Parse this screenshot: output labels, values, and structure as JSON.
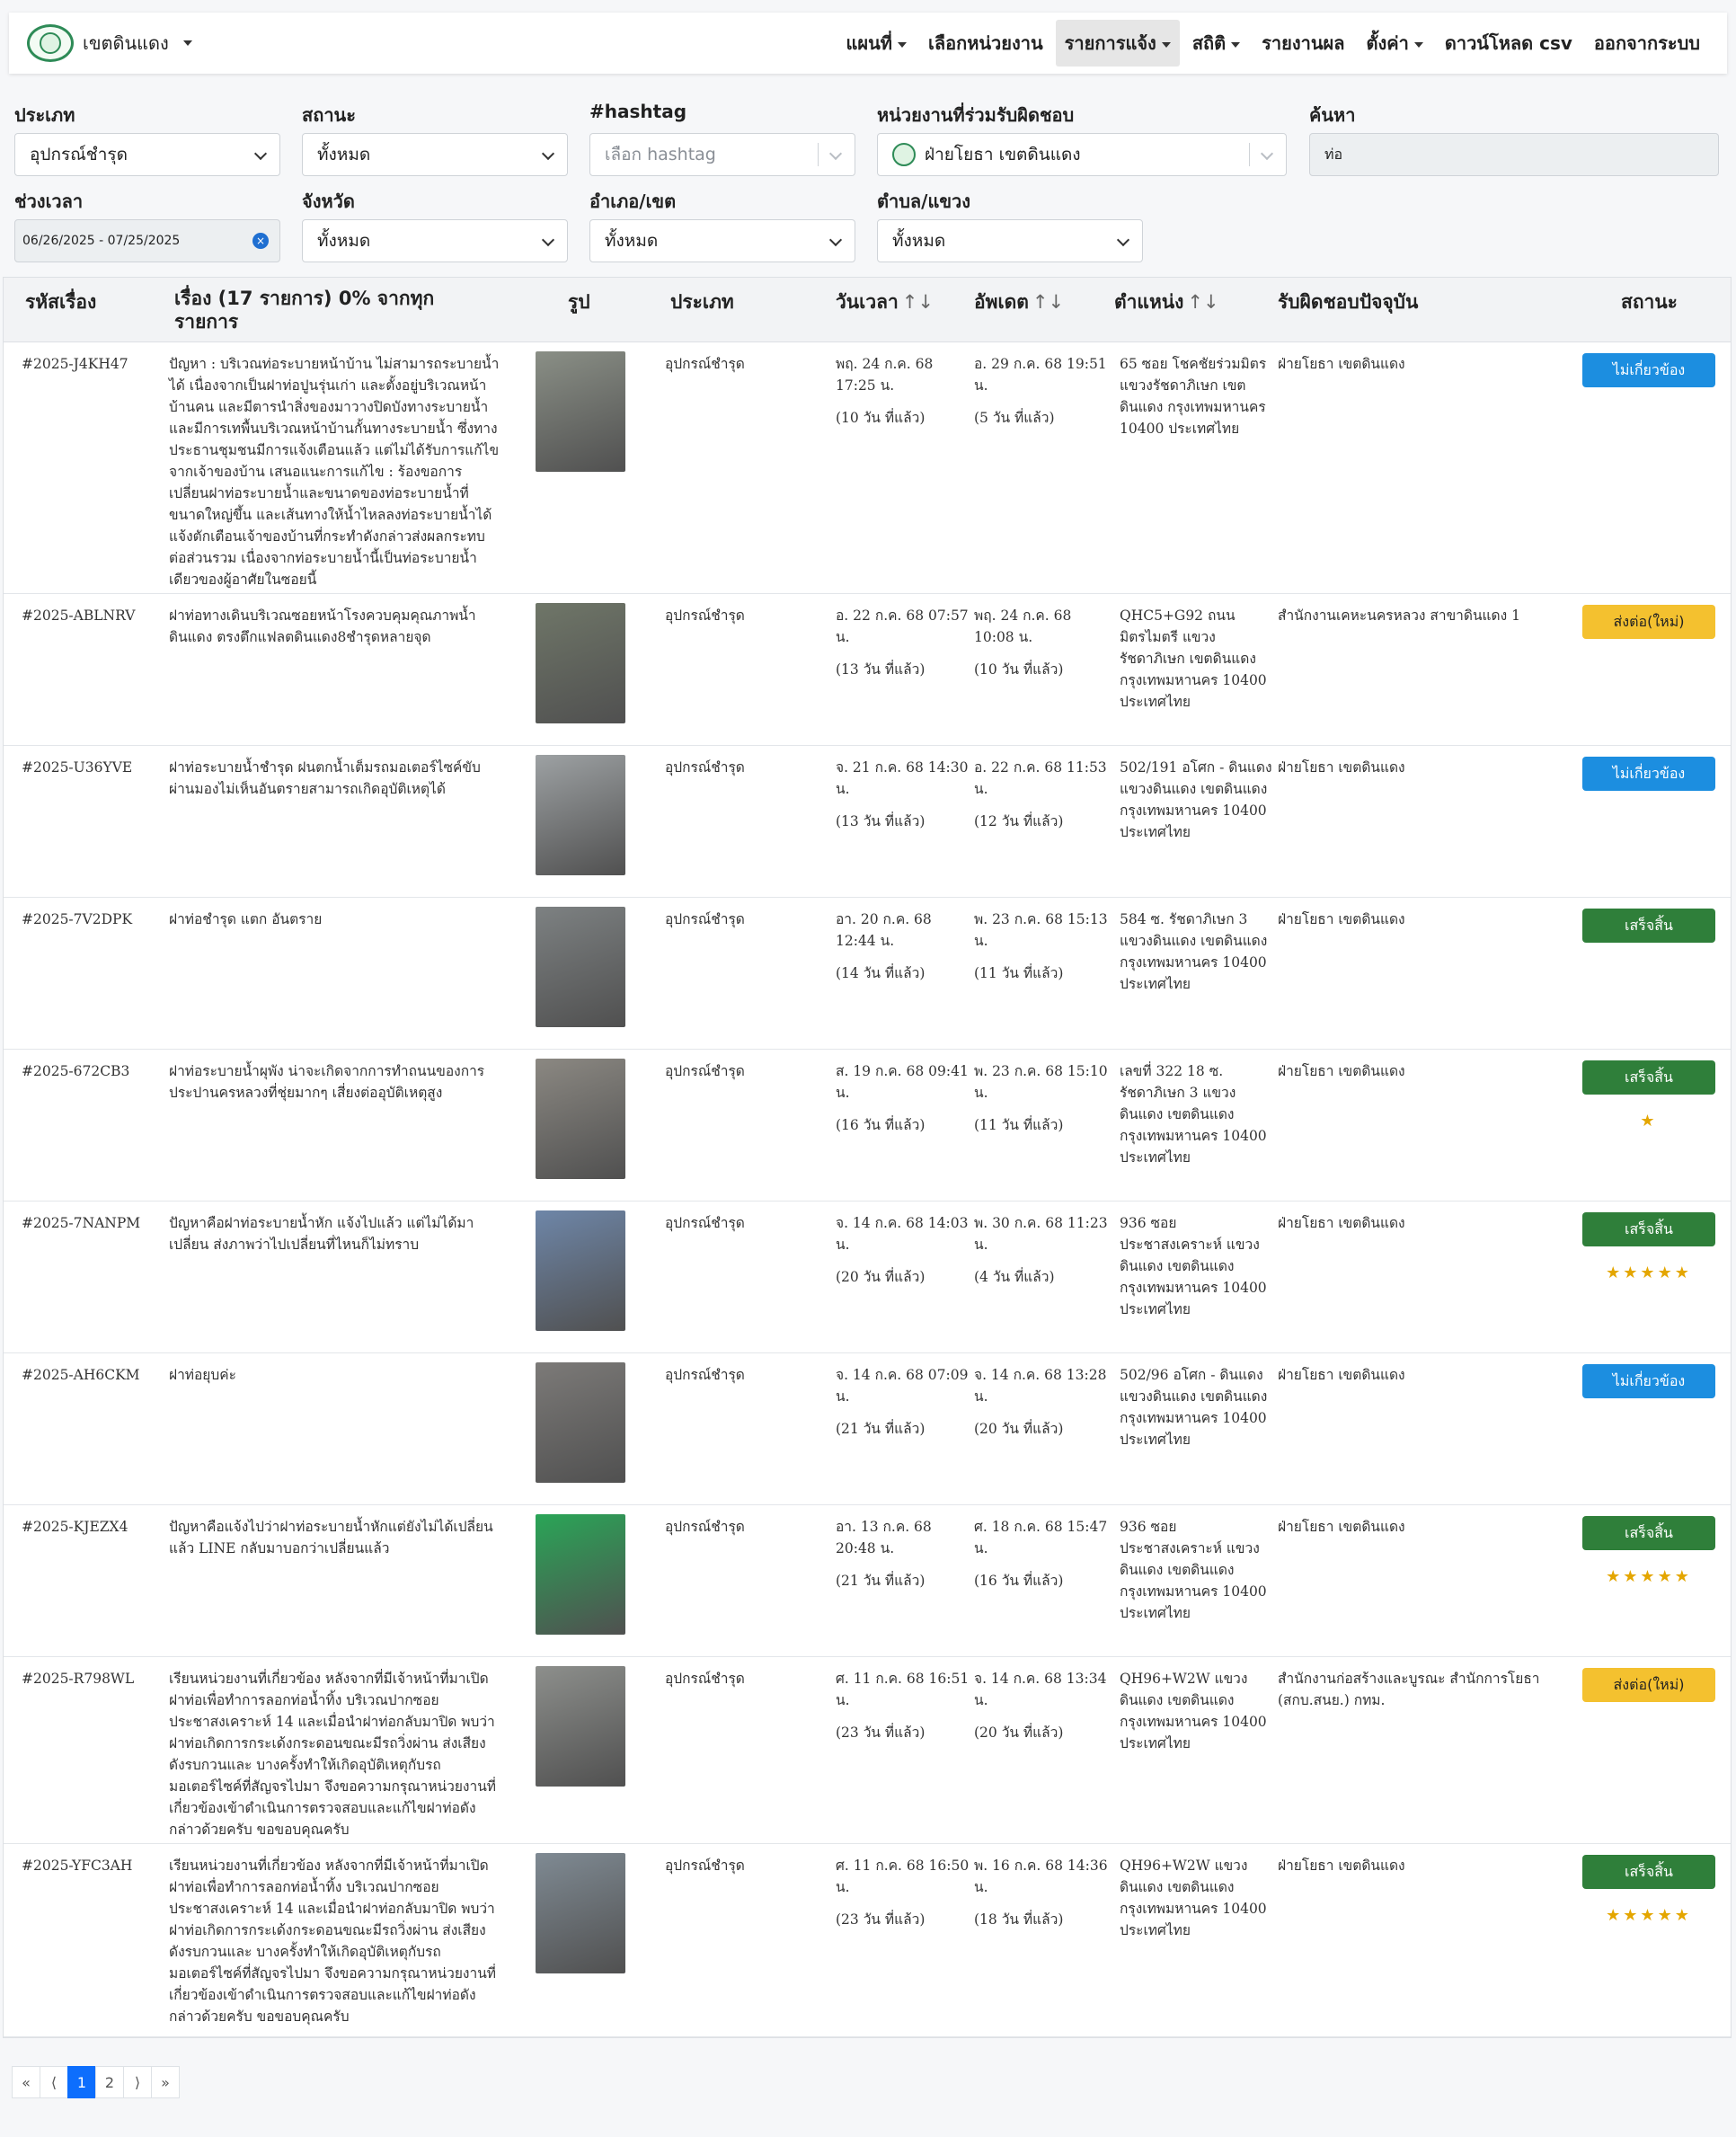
{
  "navbar": {
    "brand": "เขตดินแดง",
    "menu": [
      {
        "label": "แผนที่",
        "caret": true,
        "active": false
      },
      {
        "label": "เลือกหน่วยงาน",
        "caret": false,
        "active": false
      },
      {
        "label": "รายการแจ้ง",
        "caret": true,
        "active": true
      },
      {
        "label": "สถิติ",
        "caret": true,
        "active": false
      },
      {
        "label": "รายงานผล",
        "caret": false,
        "active": false
      },
      {
        "label": "ตั้งค่า",
        "caret": true,
        "active": false
      },
      {
        "label": "ดาวน์โหลด csv",
        "caret": false,
        "active": false
      },
      {
        "label": "ออกจากระบบ",
        "caret": false,
        "active": false
      }
    ]
  },
  "filters": {
    "type": {
      "label": "ประเภท",
      "value": "อุปกรณ์ชำรุด"
    },
    "status": {
      "label": "สถานะ",
      "value": "ทั้งหมด"
    },
    "hashtag": {
      "label": "#hashtag",
      "placeholder": "เลือก hashtag"
    },
    "unit": {
      "label": "หน่วยงานที่ร่วมรับผิดชอบ",
      "value": "ฝ่ายโยธา เขตดินแดง"
    },
    "search": {
      "label": "ค้นหา",
      "value": "ท่อ"
    },
    "period": {
      "label": "ช่วงเวลา",
      "value": "06/26/2025 - 07/25/2025"
    },
    "province": {
      "label": "จังหวัด",
      "value": "ทั้งหมด"
    },
    "district": {
      "label": "อำเภอ/เขต",
      "value": "ทั้งหมด"
    },
    "subdistrict": {
      "label": "ตำบล/แขวง",
      "value": "ทั้งหมด"
    }
  },
  "table": {
    "headers": {
      "id": "รหัสเรื่อง",
      "title": "เรื่อง (17 รายการ) 0% จากทุกรายการ",
      "image": "รูป",
      "type": "ประเภท",
      "date": "วันเวลา",
      "updated": "อัพเดต",
      "location": "ตำแหน่ง",
      "responsible": "รับผิดชอบปัจจุบัน",
      "status": "สถานะ",
      "sort_icon": "↑↓"
    },
    "rows": [
      {
        "id": "#2025-J4KH47",
        "title": "ปัญหา : บริเวณท่อระบายหน้าบ้าน ไม่สามารถระบายน้ำได้ เนื่องจากเป็นฝาท่อปูนรุ่นเก่า และตั้งอยู่บริเวณหน้าบ้านคน และมีตารนำสิ่งของมาวางปิดบังทางระบายน้ำ และมีการเทพื้นบริเวณหน้าบ้านกั้นทางระบายน้ำ ซึ่งทางประธานชุมชนมีการแจ้งเตือนแล้ว แต่ไม่ได้รับการแก้ไขจากเจ้าของบ้าน เสนอแนะการแก้ไข : ร้องขอการเปลี่ยนฝาท่อระบายน้ำและขนาดของท่อระบายน้ำที่ขนาดใหญ่ขึ้น และเส้นทางให้น้ำไหลลงท่อระบายน้ำได้ แจ้งตักเตือนเจ้าของบ้านที่กระทำดังกล่าวส่งผลกระทบต่อส่วนรวม เนื่องจากท่อระบายน้ำนี้เป็นท่อระบายน้ำเดียวของผู้อาศัยในซอยนี้",
        "type": "อุปกรณ์ชำรุด",
        "date": "พฤ. 24 ก.ค. 68 17:25 น.",
        "date_rel": "(10 วัน ที่แล้ว)",
        "updated": "อ. 29 ก.ค. 68 19:51 น.",
        "updated_rel": "(5 วัน ที่แล้ว)",
        "location": "65 ซอย โชคชัยร่วมมิตร แขวงรัชดาภิเษก เขตดินแดง กรุงเทพมหานคร 10400 ประเทศไทย",
        "responsible": "ฝ่ายโยธา เขตดินแดง",
        "status": "ไม่เกี่ยวข้อง",
        "status_color": "blue",
        "stars": "",
        "img_color": "#8a8f86"
      },
      {
        "id": "#2025-ABLNRV",
        "title": "ฝาท่อทางเดินบริเวณซอยหน้าโรงควบคุมคุณภาพน้ำดินแดง ตรงตึกแฟลตดินแดง8ชำรุดหลายจุด",
        "type": "อุปกรณ์ชำรุด",
        "date": "อ. 22 ก.ค. 68 07:57 น.",
        "date_rel": "(13 วัน ที่แล้ว)",
        "updated": "พฤ. 24 ก.ค. 68 10:08 น.",
        "updated_rel": "(10 วัน ที่แล้ว)",
        "location": "QHC5+G92 ถนนมิตรไมตรี แขวงรัชดาภิเษก เขตดินแดง กรุงเทพมหานคร 10400 ประเทศไทย",
        "responsible": "สำนักงานเคหะนครหลวง สาขาดินแดง 1",
        "status": "ส่งต่อ(ใหม่)",
        "status_color": "yellow",
        "stars": "",
        "img_color": "#6f7668"
      },
      {
        "id": "#2025-U36YVE",
        "title": "ฝาท่อระบายน้ำชำรุด ฝนตกน้ำเต็มรถมอเตอร์ไซค์ขับผ่านมองไม่เห็นอันตรายสามารถเกิดอุบัติเหตุได้",
        "type": "อุปกรณ์ชำรุด",
        "date": "จ. 21 ก.ค. 68 14:30 น.",
        "date_rel": "(13 วัน ที่แล้ว)",
        "updated": "อ. 22 ก.ค. 68 11:53 น.",
        "updated_rel": "(12 วัน ที่แล้ว)",
        "location": "502/191 อโศก - ดินแดง แขวงดินแดง เขตดินแดง กรุงเทพมหานคร 10400 ประเทศไทย",
        "responsible": "ฝ่ายโยธา เขตดินแดง",
        "status": "ไม่เกี่ยวข้อง",
        "status_color": "blue",
        "stars": "",
        "img_color": "#9da1a3"
      },
      {
        "id": "#2025-7V2DPK",
        "title": "ฝาท่อชำรุด แตก อันตราย",
        "type": "อุปกรณ์ชำรุด",
        "date": "อา. 20 ก.ค. 68 12:44 น.",
        "date_rel": "(14 วัน ที่แล้ว)",
        "updated": "พ. 23 ก.ค. 68 15:13 น.",
        "updated_rel": "(11 วัน ที่แล้ว)",
        "location": "584 ซ. รัชดาภิเษก 3 แขวงดินแดง เขตดินแดง กรุงเทพมหานคร 10400 ประเทศไทย",
        "responsible": "ฝ่ายโยธา เขตดินแดง",
        "status": "เสร็จสิ้น",
        "status_color": "green",
        "stars": "",
        "img_color": "#7d8182"
      },
      {
        "id": "#2025-672CB3",
        "title": "ฝาท่อระบายน้ำผุพัง น่าจะเกิดจากการทำถนนของการประปานครหลวงที่ชุ่ยมากๆ เสี่ยงต่ออุบัติเหตุสูง",
        "type": "อุปกรณ์ชำรุด",
        "date": "ส. 19 ก.ค. 68 09:41 น.",
        "date_rel": "(16 วัน ที่แล้ว)",
        "updated": "พ. 23 ก.ค. 68 15:10 น.",
        "updated_rel": "(11 วัน ที่แล้ว)",
        "location": "เลขที่ 322 18 ซ. รัชดาภิเษก 3 แขวงดินแดง เขตดินแดง กรุงเทพมหานคร 10400 ประเทศไทย",
        "responsible": "ฝ่ายโยธา เขตดินแดง",
        "status": "เสร็จสิ้น",
        "status_color": "green",
        "stars": "★",
        "img_color": "#8b8882"
      },
      {
        "id": "#2025-7NANPM",
        "title": "ปัญหาคือฝาท่อระบายน้ำหัก แจ้งไปแล้ว แต่ไม่ได้มาเปลี่ยน ส่งภาพว่าไปเปลี่ยนที่ไหนก็ไม่ทราบ",
        "type": "อุปกรณ์ชำรุด",
        "date": "จ. 14 ก.ค. 68 14:03 น.",
        "date_rel": "(20 วัน ที่แล้ว)",
        "updated": "พ. 30 ก.ค. 68 11:23 น.",
        "updated_rel": "(4 วัน ที่แล้ว)",
        "location": "936 ซอย ประชาสงเคราะห์ แขวงดินแดง เขตดินแดง กรุงเทพมหานคร 10400 ประเทศไทย",
        "responsible": "ฝ่ายโยธา เขตดินแดง",
        "status": "เสร็จสิ้น",
        "status_color": "green",
        "stars": "★★★★★",
        "img_color": "#6e86a8"
      },
      {
        "id": "#2025-AH6CKM",
        "title": "ฝาท่อยุบค่ะ",
        "type": "อุปกรณ์ชำรุด",
        "date": "จ. 14 ก.ค. 68 07:09 น.",
        "date_rel": "(21 วัน ที่แล้ว)",
        "updated": "จ. 14 ก.ค. 68 13:28 น.",
        "updated_rel": "(20 วัน ที่แล้ว)",
        "location": "502/96 อโศก - ดินแดง แขวงดินแดง เขตดินแดง กรุงเทพมหานคร 10400 ประเทศไทย",
        "responsible": "ฝ่ายโยธา เขตดินแดง",
        "status": "ไม่เกี่ยวข้อง",
        "status_color": "blue",
        "stars": "",
        "img_color": "#7c7a78"
      },
      {
        "id": "#2025-KJEZX4",
        "title": "ปัญหาคือแจ้งไปว่าฝาท่อระบายน้ำหักแต่ยังไม่ได้เปลี่ยน แล้ว LINE กลับมาบอกว่าเปลี่ยนแล้ว",
        "type": "อุปกรณ์ชำรุด",
        "date": "อา. 13 ก.ค. 68 20:48 น.",
        "date_rel": "(21 วัน ที่แล้ว)",
        "updated": "ศ. 18 ก.ค. 68 15:47 น.",
        "updated_rel": "(16 วัน ที่แล้ว)",
        "location": "936 ซอย ประชาสงเคราะห์ แขวงดินแดง เขตดินแดง กรุงเทพมหานคร 10400 ประเทศไทย",
        "responsible": "ฝ่ายโยธา เขตดินแดง",
        "status": "เสร็จสิ้น",
        "status_color": "green",
        "stars": "★★★★★",
        "img_color": "#2aa557"
      },
      {
        "id": "#2025-R798WL",
        "title": "เรียนหน่วยงานที่เกี่ยวข้อง หลังจากที่มีเจ้าหน้าที่มาเปิดฝาท่อเพื่อทำการลอกท่อน้ำทิ้ง บริเวณปากซอยประชาสงเคราะห์ 14 และเมื่อนำฝาท่อกลับมาปิด พบว่าฝาท่อเกิดการกระเด้งกระดอนขณะมีรถวิ่งผ่าน ส่งเสียงดังรบกวนและ บางครั้งทำให้เกิดอุบัติเหตุกับรถมอเตอร์ไซค์ที่สัญจรไปมา จึงขอความกรุณาหน่วยงานที่เกี่ยวข้องเข้าดำเนินการตรวจสอบและแก้ไขฝาท่อดังกล่าวด้วยครับ ขอขอบคุณครับ",
        "type": "อุปกรณ์ชำรุด",
        "date": "ศ. 11 ก.ค. 68 16:51 น.",
        "date_rel": "(23 วัน ที่แล้ว)",
        "updated": "จ. 14 ก.ค. 68 13:34 น.",
        "updated_rel": "(20 วัน ที่แล้ว)",
        "location": "QH96+W2W แขวงดินแดง เขตดินแดง กรุงเทพมหานคร 10400 ประเทศไทย",
        "responsible": "สำนักงานก่อสร้างและบูรณะ สำนักการโยธา (สกบ.สนย.) กทม.",
        "status": "ส่งต่อ(ใหม่)",
        "status_color": "yellow",
        "stars": "",
        "img_color": "#8d8f8c"
      },
      {
        "id": "#2025-YFC3AH",
        "title": "เรียนหน่วยงานที่เกี่ยวข้อง หลังจากที่มีเจ้าหน้าที่มาเปิดฝาท่อเพื่อทำการลอกท่อน้ำทิ้ง บริเวณปากซอยประชาสงเคราะห์ 14 และเมื่อนำฝาท่อกลับมาปิด พบว่าฝาท่อเกิดการกระเด้งกระดอนขณะมีรถวิ่งผ่าน ส่งเสียงดังรบกวนและ บางครั้งทำให้เกิดอุบัติเหตุกับรถมอเตอร์ไซค์ที่สัญจรไปมา จึงขอความกรุณาหน่วยงานที่เกี่ยวข้องเข้าดำเนินการตรวจสอบและแก้ไขฝาท่อดังกล่าวด้วยครับ ขอขอบคุณครับ",
        "type": "อุปกรณ์ชำรุด",
        "date": "ศ. 11 ก.ค. 68 16:50 น.",
        "date_rel": "(23 วัน ที่แล้ว)",
        "updated": "พ. 16 ก.ค. 68 14:36 น.",
        "updated_rel": "(18 วัน ที่แล้ว)",
        "location": "QH96+W2W แขวงดินแดง เขตดินแดง กรุงเทพมหานคร 10400 ประเทศไทย",
        "responsible": "ฝ่ายโยธา เขตดินแดง",
        "status": "เสร็จสิ้น",
        "status_color": "green",
        "stars": "★★★★★",
        "img_color": "#7f8a93"
      }
    ]
  },
  "pagination": {
    "first": "«",
    "prev": "⟨",
    "pages": [
      "1",
      "2"
    ],
    "current": "1",
    "next": "⟩",
    "last": "»"
  }
}
